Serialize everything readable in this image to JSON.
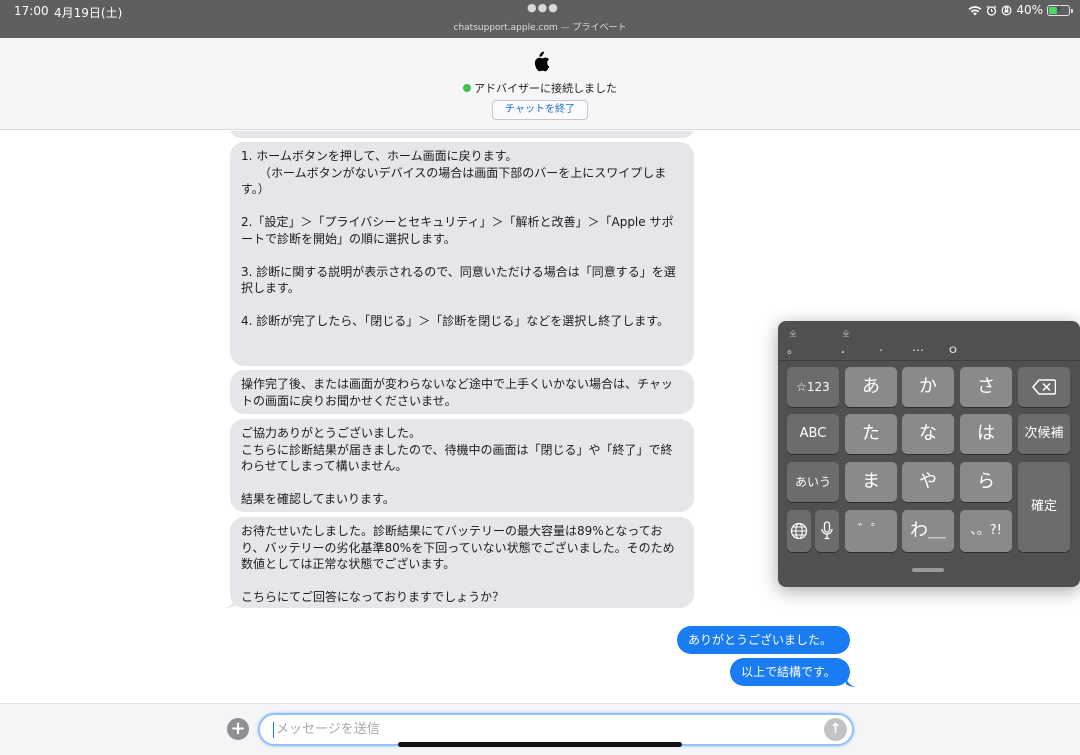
{
  "status_bar": {
    "time": "17:00",
    "date": "4月19日(土)",
    "url": "chatsupport.apple.com",
    "private_label": "プライベート",
    "battery_percent": "40%",
    "battery_level": 0.4,
    "battery_color": "#4cd964"
  },
  "header": {
    "status": "アドバイザーに接続しました",
    "end_chat_label": "チャットを終了",
    "status_color": "#3fc04f"
  },
  "messages": [
    {
      "direction": "incoming",
      "text": "1. ホームボタンを押して、ホーム画面に戻ります。\n　　（ホームボタンがないデバイスの場合は画面下部のバーを上にスワイプします。）\n\n2.「設定」＞「プライバシーとセキュリティ」＞「解析と改善」＞「Apple サポートで診断を開始」の順に選択します。\n\n3. 診断に関する説明が表示されるので、同意いただける場合は「同意する」を選択します。\n\n4. 診断が完了したら、「閉じる」＞「診断を閉じる」などを選択し終了します。\n"
    },
    {
      "direction": "incoming",
      "text": "操作完了後、または画面が変わらないなど途中で上手くいかない場合は、チャットの画面に戻りお聞かせくださいませ。"
    },
    {
      "direction": "incoming",
      "text": "ご協力ありがとうございました。\nこちらに診断結果が届きましたので、待機中の画面は「閉じる」や「終了」で終わらせてしまって構いません。\n\n結果を確認してまいります。"
    },
    {
      "direction": "incoming",
      "text": "お待たせいたしました。診断結果にてバッテリーの最大容量は89%となっており、バッテリーの劣化基準80%を下回っていない状態でございました。そのため数値としては正常な状態でございます。\n\nこちらにてご回答になっておりますでしょうか？"
    },
    {
      "direction": "outgoing",
      "text": "ありがとうございました。"
    },
    {
      "direction": "outgoing",
      "text": "以上で結構です。"
    }
  ],
  "input": {
    "placeholder": "メッセージを送信"
  },
  "keyboard": {
    "candidates": [
      {
        "label": "。",
        "note": "全"
      },
      {
        "label": "．",
        "note": "全"
      },
      {
        "label": ".",
        "note": ""
      },
      {
        "label": "…",
        "note": ""
      },
      {
        "label": "ｏ",
        "note": ""
      }
    ],
    "keys": {
      "symbols": "☆123",
      "a": "あ",
      "ka": "か",
      "sa": "さ",
      "abc": "ABC",
      "ta": "た",
      "na": "な",
      "ha": "は",
      "next_candidate": "次候補",
      "aiu": "あいう",
      "ma": "ま",
      "ya": "や",
      "ra": "ら",
      "confirm": "確定",
      "dakuten": "゛゜",
      "wa": "わ＿",
      "punct": "、。?!"
    }
  },
  "colors": {
    "outgoing_bubble": "#1a7cf2",
    "incoming_bubble": "#e5e5ea"
  }
}
